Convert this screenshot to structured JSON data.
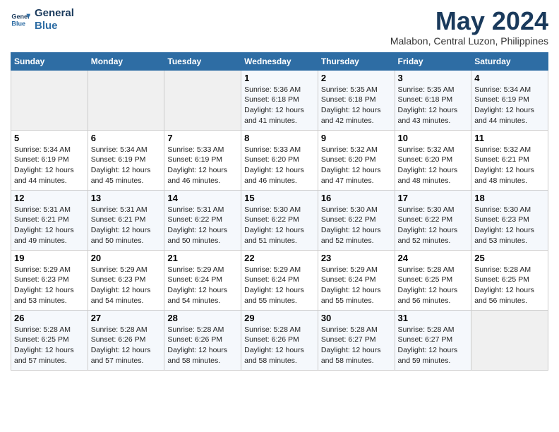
{
  "header": {
    "logo_line1": "General",
    "logo_line2": "Blue",
    "month": "May 2024",
    "location": "Malabon, Central Luzon, Philippines"
  },
  "weekdays": [
    "Sunday",
    "Monday",
    "Tuesday",
    "Wednesday",
    "Thursday",
    "Friday",
    "Saturday"
  ],
  "weeks": [
    [
      {
        "day": "",
        "info": ""
      },
      {
        "day": "",
        "info": ""
      },
      {
        "day": "",
        "info": ""
      },
      {
        "day": "1",
        "info": "Sunrise: 5:36 AM\nSunset: 6:18 PM\nDaylight: 12 hours\nand 41 minutes."
      },
      {
        "day": "2",
        "info": "Sunrise: 5:35 AM\nSunset: 6:18 PM\nDaylight: 12 hours\nand 42 minutes."
      },
      {
        "day": "3",
        "info": "Sunrise: 5:35 AM\nSunset: 6:18 PM\nDaylight: 12 hours\nand 43 minutes."
      },
      {
        "day": "4",
        "info": "Sunrise: 5:34 AM\nSunset: 6:19 PM\nDaylight: 12 hours\nand 44 minutes."
      }
    ],
    [
      {
        "day": "5",
        "info": "Sunrise: 5:34 AM\nSunset: 6:19 PM\nDaylight: 12 hours\nand 44 minutes."
      },
      {
        "day": "6",
        "info": "Sunrise: 5:34 AM\nSunset: 6:19 PM\nDaylight: 12 hours\nand 45 minutes."
      },
      {
        "day": "7",
        "info": "Sunrise: 5:33 AM\nSunset: 6:19 PM\nDaylight: 12 hours\nand 46 minutes."
      },
      {
        "day": "8",
        "info": "Sunrise: 5:33 AM\nSunset: 6:20 PM\nDaylight: 12 hours\nand 46 minutes."
      },
      {
        "day": "9",
        "info": "Sunrise: 5:32 AM\nSunset: 6:20 PM\nDaylight: 12 hours\nand 47 minutes."
      },
      {
        "day": "10",
        "info": "Sunrise: 5:32 AM\nSunset: 6:20 PM\nDaylight: 12 hours\nand 48 minutes."
      },
      {
        "day": "11",
        "info": "Sunrise: 5:32 AM\nSunset: 6:21 PM\nDaylight: 12 hours\nand 48 minutes."
      }
    ],
    [
      {
        "day": "12",
        "info": "Sunrise: 5:31 AM\nSunset: 6:21 PM\nDaylight: 12 hours\nand 49 minutes."
      },
      {
        "day": "13",
        "info": "Sunrise: 5:31 AM\nSunset: 6:21 PM\nDaylight: 12 hours\nand 50 minutes."
      },
      {
        "day": "14",
        "info": "Sunrise: 5:31 AM\nSunset: 6:22 PM\nDaylight: 12 hours\nand 50 minutes."
      },
      {
        "day": "15",
        "info": "Sunrise: 5:30 AM\nSunset: 6:22 PM\nDaylight: 12 hours\nand 51 minutes."
      },
      {
        "day": "16",
        "info": "Sunrise: 5:30 AM\nSunset: 6:22 PM\nDaylight: 12 hours\nand 52 minutes."
      },
      {
        "day": "17",
        "info": "Sunrise: 5:30 AM\nSunset: 6:22 PM\nDaylight: 12 hours\nand 52 minutes."
      },
      {
        "day": "18",
        "info": "Sunrise: 5:30 AM\nSunset: 6:23 PM\nDaylight: 12 hours\nand 53 minutes."
      }
    ],
    [
      {
        "day": "19",
        "info": "Sunrise: 5:29 AM\nSunset: 6:23 PM\nDaylight: 12 hours\nand 53 minutes."
      },
      {
        "day": "20",
        "info": "Sunrise: 5:29 AM\nSunset: 6:23 PM\nDaylight: 12 hours\nand 54 minutes."
      },
      {
        "day": "21",
        "info": "Sunrise: 5:29 AM\nSunset: 6:24 PM\nDaylight: 12 hours\nand 54 minutes."
      },
      {
        "day": "22",
        "info": "Sunrise: 5:29 AM\nSunset: 6:24 PM\nDaylight: 12 hours\nand 55 minutes."
      },
      {
        "day": "23",
        "info": "Sunrise: 5:29 AM\nSunset: 6:24 PM\nDaylight: 12 hours\nand 55 minutes."
      },
      {
        "day": "24",
        "info": "Sunrise: 5:28 AM\nSunset: 6:25 PM\nDaylight: 12 hours\nand 56 minutes."
      },
      {
        "day": "25",
        "info": "Sunrise: 5:28 AM\nSunset: 6:25 PM\nDaylight: 12 hours\nand 56 minutes."
      }
    ],
    [
      {
        "day": "26",
        "info": "Sunrise: 5:28 AM\nSunset: 6:25 PM\nDaylight: 12 hours\nand 57 minutes."
      },
      {
        "day": "27",
        "info": "Sunrise: 5:28 AM\nSunset: 6:26 PM\nDaylight: 12 hours\nand 57 minutes."
      },
      {
        "day": "28",
        "info": "Sunrise: 5:28 AM\nSunset: 6:26 PM\nDaylight: 12 hours\nand 58 minutes."
      },
      {
        "day": "29",
        "info": "Sunrise: 5:28 AM\nSunset: 6:26 PM\nDaylight: 12 hours\nand 58 minutes."
      },
      {
        "day": "30",
        "info": "Sunrise: 5:28 AM\nSunset: 6:27 PM\nDaylight: 12 hours\nand 58 minutes."
      },
      {
        "day": "31",
        "info": "Sunrise: 5:28 AM\nSunset: 6:27 PM\nDaylight: 12 hours\nand 59 minutes."
      },
      {
        "day": "",
        "info": ""
      }
    ]
  ]
}
